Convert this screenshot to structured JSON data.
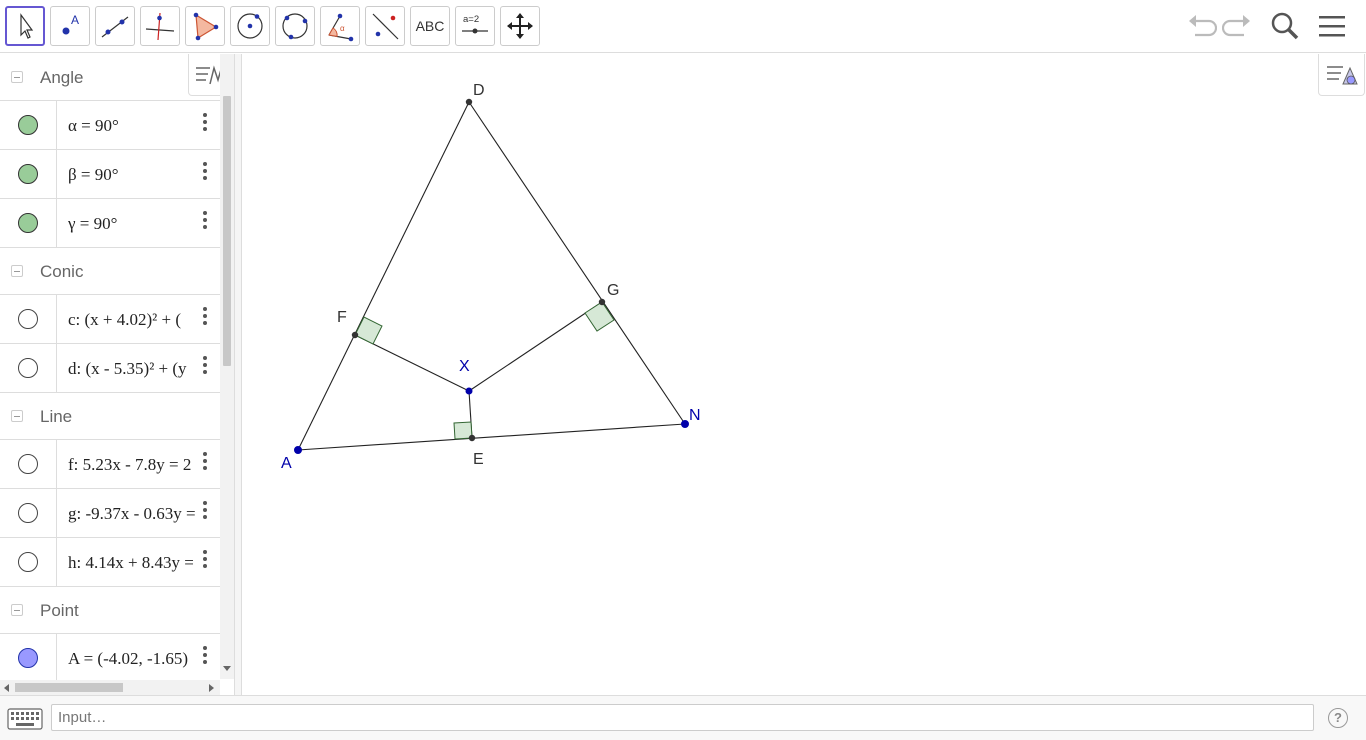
{
  "toolbar": {
    "tools": [
      {
        "name": "move-tool",
        "icon": "arrow-cursor-icon"
      },
      {
        "name": "point-tool",
        "icon": "point-icon"
      },
      {
        "name": "line-tool",
        "icon": "line-icon"
      },
      {
        "name": "perpendicular-line-tool",
        "icon": "perpendicular-icon"
      },
      {
        "name": "polygon-tool",
        "icon": "polygon-icon"
      },
      {
        "name": "circle-center-point-tool",
        "icon": "circle-center-icon"
      },
      {
        "name": "circle-three-points-tool",
        "icon": "circle-three-points-icon"
      },
      {
        "name": "angle-tool",
        "icon": "angle-icon"
      },
      {
        "name": "reflect-tool",
        "icon": "reflect-icon"
      },
      {
        "name": "text-tool",
        "icon": "text-icon",
        "label": "ABC"
      },
      {
        "name": "slider-tool",
        "icon": "slider-icon",
        "label": "a = 2"
      },
      {
        "name": "move-graphics-tool",
        "icon": "move-arrows-icon"
      }
    ],
    "undo_icon": "undo-icon",
    "redo_icon": "redo-icon",
    "search_icon": "search-icon",
    "menu_icon": "hamburger-menu-icon"
  },
  "algebra": {
    "groups": [
      {
        "title": "Angle",
        "items": [
          {
            "text": "α = 90°",
            "color": "#99cc99",
            "visible": true
          },
          {
            "text": "β = 90°",
            "color": "#99cc99",
            "visible": true
          },
          {
            "text": "γ = 90°",
            "color": "#99cc99",
            "visible": true
          }
        ]
      },
      {
        "title": "Conic",
        "items": [
          {
            "text": "c: (x + 4.02)² + (",
            "color": "#ffffff",
            "visible": false
          },
          {
            "text": "d: (x - 5.35)² + (y",
            "color": "#ffffff",
            "visible": false
          }
        ]
      },
      {
        "title": "Line",
        "items": [
          {
            "text": "f: 5.23x - 7.8y = 2",
            "color": "#ffffff",
            "visible": false
          },
          {
            "text": "g: -9.37x - 0.63y =",
            "color": "#ffffff",
            "visible": false
          },
          {
            "text": "h: 4.14x + 8.43y =",
            "color": "#ffffff",
            "visible": false
          }
        ]
      },
      {
        "title": "Point",
        "items": [
          {
            "text": "A = (-4.02, -1.65)",
            "color": "#9999ff",
            "visible": true
          }
        ]
      }
    ]
  },
  "graphics": {
    "points": [
      {
        "id": "A",
        "label": "A",
        "color": "#0000aa"
      },
      {
        "id": "N",
        "label": "N",
        "color": "#0000aa"
      },
      {
        "id": "D",
        "label": "D",
        "color": "#222222"
      },
      {
        "id": "F",
        "label": "F",
        "color": "#222222"
      },
      {
        "id": "G",
        "label": "G",
        "color": "#222222"
      },
      {
        "id": "E",
        "label": "E",
        "color": "#222222"
      },
      {
        "id": "X",
        "label": "X",
        "color": "#0000aa"
      }
    ],
    "right_angle_fill": "#d6e8d6",
    "right_angle_stroke": "#336633"
  },
  "input": {
    "placeholder": "Input…"
  },
  "help": {
    "label": "?"
  }
}
